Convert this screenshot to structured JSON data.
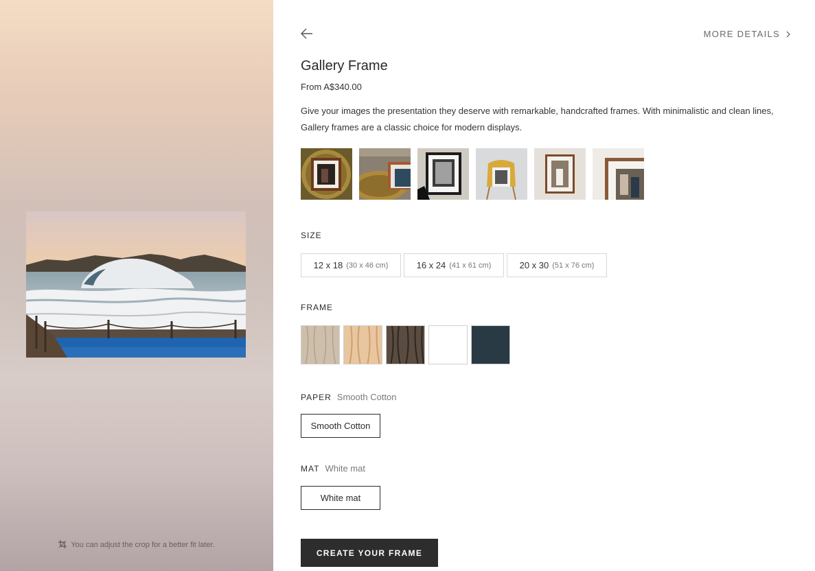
{
  "preview": {
    "crop_note": "You can adjust the crop for a better fit later.",
    "image_icon": "ocean-wave-photo"
  },
  "header": {
    "back_icon": "arrow-left-icon",
    "more_details": "MORE DETAILS"
  },
  "product": {
    "title": "Gallery Frame",
    "price": "From A$340.00",
    "description": "Give your images the presentation they deserve with remarkable, handcrafted frames. With minimalistic and clean lines, Gallery frames are a classic choice for modern displays."
  },
  "size": {
    "label": "SIZE",
    "options": [
      {
        "size": "12 x 18",
        "cm": "(30 x 46 cm)"
      },
      {
        "size": "16 x 24",
        "cm": "(41 x 61 cm)"
      },
      {
        "size": "20 x 30",
        "cm": "(51 x 76 cm)"
      }
    ]
  },
  "frame": {
    "label": "FRAME",
    "swatches": [
      "light-oak",
      "natural-ash",
      "dark-walnut",
      "white",
      "charcoal"
    ]
  },
  "paper": {
    "label": "PAPER",
    "selected": "Smooth Cotton",
    "option": "Smooth Cotton"
  },
  "mat": {
    "label": "MAT",
    "selected": "White mat",
    "option": "White mat"
  },
  "cta": "CREATE YOUR FRAME",
  "colors": {
    "cta_background": "#2d2d2d",
    "border": "#d8d8d8",
    "selected_border": "#2a2a2a"
  }
}
